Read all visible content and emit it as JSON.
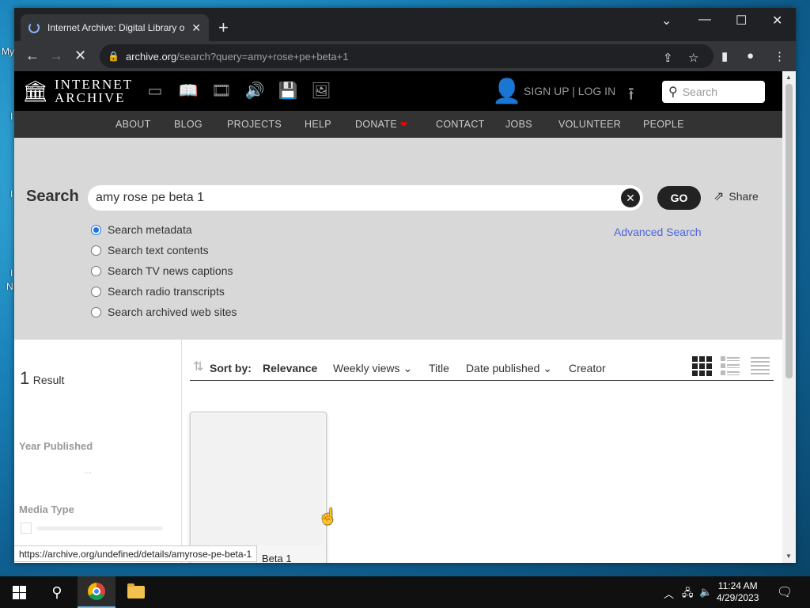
{
  "desktop": {
    "labels": [
      "My",
      "I",
      "I",
      "I",
      "N"
    ]
  },
  "browser": {
    "tab_title": "Internet Archive: Digital Library o",
    "tab_close": "✕",
    "new_tab": "+",
    "url_host": "archive.org",
    "url_path": "/search?query=amy+rose+pe+beta+1",
    "status_url": "https://archive.org/undefined/details/amyrose-pe-beta-1"
  },
  "ia": {
    "logo_line1": "INTERNET",
    "logo_line2": "ARCHIVE",
    "signup_login": "SIGN UP | LOG IN",
    "search_placeholder": "Search",
    "nav": [
      "ABOUT",
      "BLOG",
      "PROJECTS",
      "HELP",
      "DONATE",
      "CONTACT",
      "JOBS",
      "VOLUNTEER",
      "PEOPLE"
    ],
    "donate_heart": "❤"
  },
  "search": {
    "label": "Search",
    "query": "amy rose pe beta 1",
    "go": "GO",
    "share": "Share",
    "advanced": "Advanced Search",
    "options": [
      {
        "label": "Search metadata",
        "checked": true
      },
      {
        "label": "Search text contents",
        "checked": false
      },
      {
        "label": "Search TV news captions",
        "checked": false
      },
      {
        "label": "Search radio transcripts",
        "checked": false
      },
      {
        "label": "Search archived web sites",
        "checked": false
      }
    ]
  },
  "facets": {
    "result_count": "1",
    "result_label": "Result",
    "year_published": "Year Published",
    "dots": "...",
    "media_type": "Media Type"
  },
  "sort": {
    "label": "Sort by:",
    "options": [
      "Relevance",
      "Weekly views",
      "Title",
      "Date published",
      "Creator"
    ],
    "active": "Relevance"
  },
  "results": [
    {
      "title_visible": "Beta 1"
    }
  ],
  "taskbar": {
    "time": "11:24 AM",
    "date": "4/29/2023"
  }
}
